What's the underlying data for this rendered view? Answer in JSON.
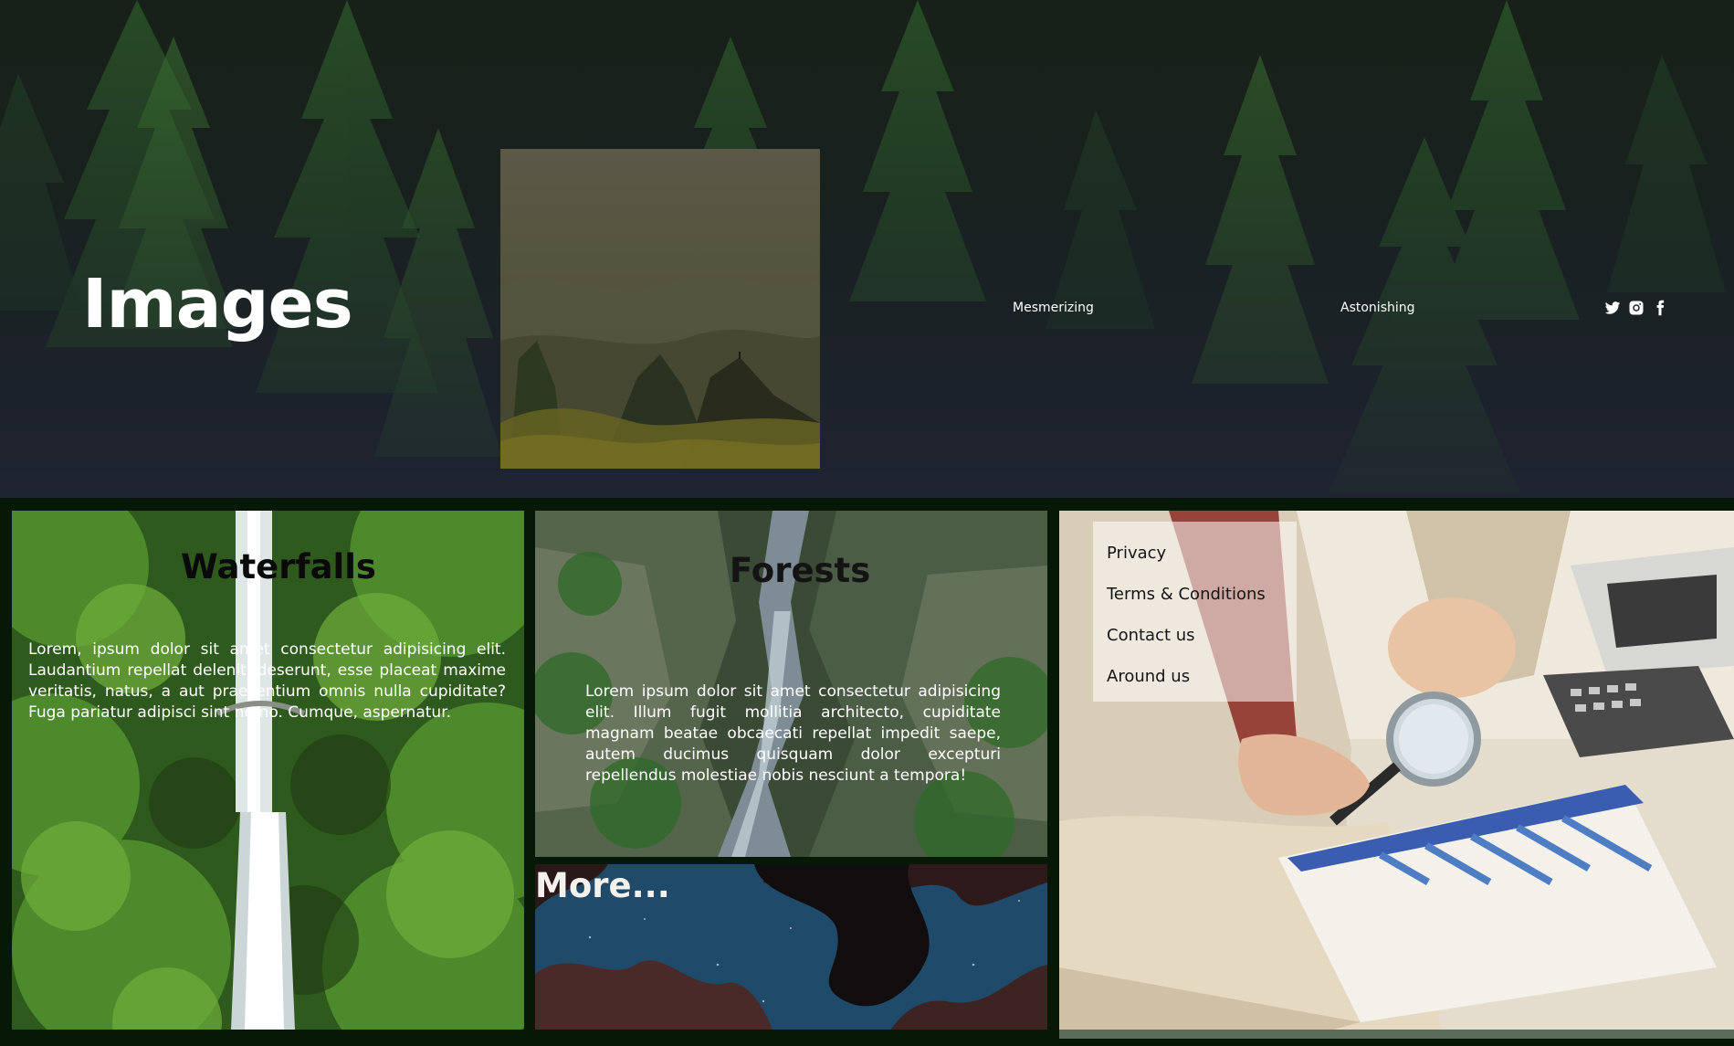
{
  "hero": {
    "title": "Images",
    "nav": [
      {
        "label": "Mesmerizing"
      },
      {
        "label": "Astonishing"
      }
    ],
    "social_icons": [
      "twitter-icon",
      "instagram-icon",
      "facebook-icon"
    ]
  },
  "cards": {
    "waterfalls": {
      "title": "Waterfalls",
      "text": "Lorem, ipsum dolor sit amet consectetur adipisicing elit. Laudantium repellat deleniti deserunt, esse placeat maxime veritatis, natus, a aut praesentium omnis nulla cupiditate? Fuga pariatur adipisci sint nemo. Cumque, aspernatur."
    },
    "forests": {
      "title": "Forests",
      "text": "Lorem ipsum dolor sit amet consectetur adipisicing elit. Illum fugit mollitia architecto, cupiditate magnam beatae obcaecati repellat impedit saepe, autem ducimus quisquam dolor excepturi repellendus molestiae nobis nesciunt a tempora!"
    },
    "more": {
      "title": "More..."
    }
  },
  "footer_links": [
    {
      "label": "Privacy"
    },
    {
      "label": "Terms & Conditions"
    },
    {
      "label": "Contact us"
    },
    {
      "label": "Around us"
    }
  ],
  "colors": {
    "page_background": "#061806",
    "hero_background": "#1e232b",
    "link_panel": "#ffffff8c"
  }
}
